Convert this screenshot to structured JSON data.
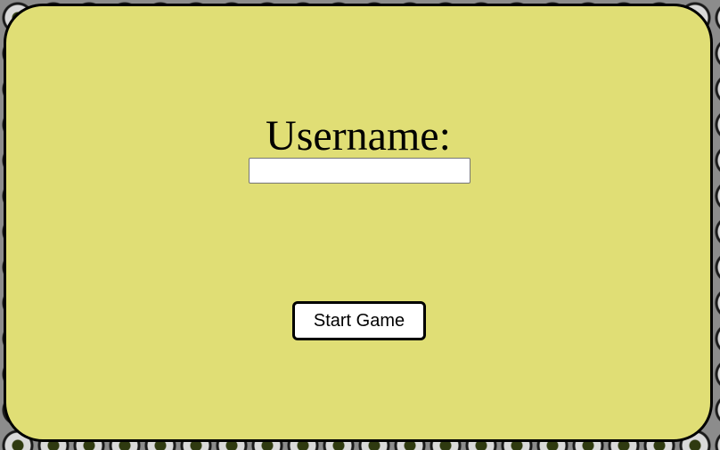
{
  "login": {
    "username_label": "Username:",
    "username_value": "",
    "username_placeholder": "",
    "start_button_label": "Start Game"
  },
  "colors": {
    "panel_background": "#e0de75",
    "panel_border": "#000000",
    "page_background": "#8c8c8c",
    "button_background": "#ffffff"
  }
}
